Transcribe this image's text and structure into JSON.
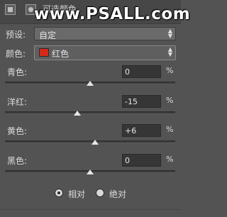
{
  "header": {
    "title": "可选颜色",
    "watermark": "www.PSALL.com"
  },
  "preset": {
    "label": "预设:",
    "value": "自定"
  },
  "colors": {
    "label": "颜色:",
    "value": "红色",
    "swatch_color": "#d42a1a"
  },
  "sliders": [
    {
      "label": "青色:",
      "value": "0",
      "unit": "%",
      "level": 0.5
    },
    {
      "label": "洋红:",
      "value": "-15",
      "unit": "%",
      "level": 0.425
    },
    {
      "label": "黄色:",
      "value": "+6",
      "unit": "%",
      "level": 0.53
    },
    {
      "label": "黑色:",
      "value": "0",
      "unit": "%",
      "level": 0.5
    }
  ],
  "method": {
    "options": [
      {
        "label": "相对",
        "checked": true
      },
      {
        "label": "绝对",
        "checked": false
      }
    ]
  }
}
